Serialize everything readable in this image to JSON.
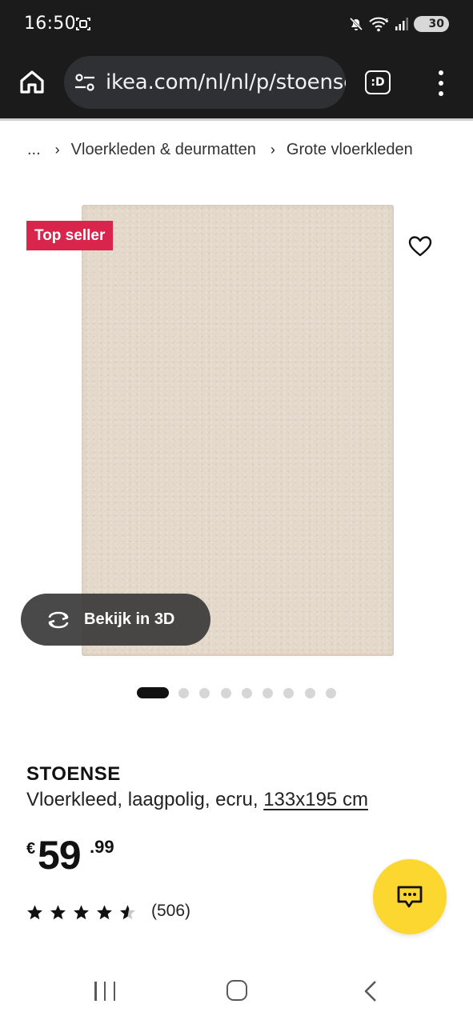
{
  "status_bar": {
    "time": "16:50",
    "battery": "30",
    "icons": [
      "screenshot-icon",
      "mute-icon",
      "wifi-icon",
      "signal-icon",
      "battery-icon"
    ]
  },
  "browser": {
    "url": "ikea.com/nl/nl/p/stoense-",
    "tab_label": ":D",
    "icons": [
      "home-icon",
      "site-settings-icon",
      "tabs-icon",
      "more-vert-icon"
    ]
  },
  "breadcrumb": {
    "ellipsis": "...",
    "items": [
      "Vloerkleden & deurmatten",
      "Grote vloerkleden"
    ]
  },
  "product_image": {
    "badge": "Top seller",
    "view_3d_label": "Bekijk in 3D",
    "carousel": {
      "total": 9,
      "active": 1
    }
  },
  "product": {
    "name": "STOENSE",
    "description": "Vloerkleed, laagpolig, ecru,",
    "size": "133x195 cm",
    "price": {
      "currency": "€",
      "integer": "59",
      "decimal": ".99"
    },
    "rating": {
      "stars": 4.5,
      "max": 5,
      "reviews": "(506)"
    }
  },
  "colors": {
    "badge": "#d9244c",
    "chat": "#fcd72f",
    "rug": "#e3d8ca",
    "chrome": "#1b1b1b"
  }
}
